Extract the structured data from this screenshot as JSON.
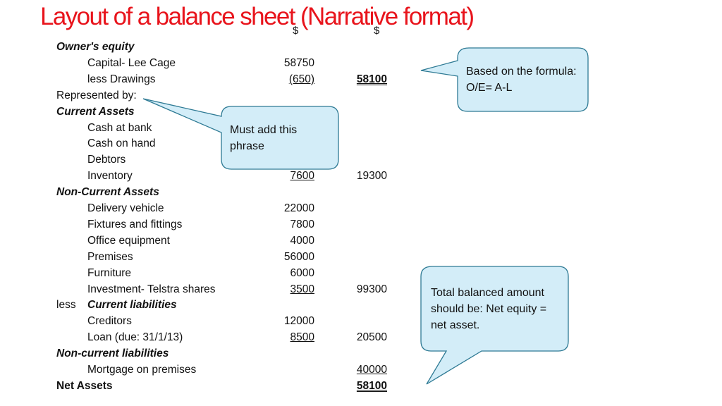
{
  "slide": {
    "title": "Layout of a balance sheet (Narrative format)",
    "col_headers": [
      "$",
      "$"
    ],
    "rows": [
      {
        "label": "Owner's equity",
        "style": "head",
        "col1": "",
        "col2": ""
      },
      {
        "label": "Capital- Lee Cage",
        "style": "item",
        "col1": "58750",
        "col2": ""
      },
      {
        "label": "less Drawings",
        "style": "item",
        "col1": "(650)",
        "col1_underline": true,
        "col2": "58100",
        "col2_style": "double"
      },
      {
        "label": "Represented by:",
        "style": "plain",
        "col1": "",
        "col2": ""
      },
      {
        "label": "Current Assets",
        "style": "head",
        "col1": "",
        "col2": ""
      },
      {
        "label": "Cash at bank",
        "style": "item",
        "col1": "",
        "col2": ""
      },
      {
        "label": "Cash on hand",
        "style": "item",
        "col1": "",
        "col2": ""
      },
      {
        "label": "Debtors",
        "style": "item",
        "col1": "",
        "col2": ""
      },
      {
        "label": "Inventory",
        "style": "item",
        "col1": "7600",
        "col1_underline": true,
        "col2": "19300"
      },
      {
        "label": "Non-Current Assets",
        "style": "head",
        "col1": "",
        "col2": ""
      },
      {
        "label": "Delivery vehicle",
        "style": "item",
        "col1": "22000",
        "col2": ""
      },
      {
        "label": "Fixtures and fittings",
        "style": "item",
        "col1": "7800",
        "col2": ""
      },
      {
        "label": "Office equipment",
        "style": "item",
        "col1": "4000",
        "col2": ""
      },
      {
        "label": "Premises",
        "style": "item",
        "col1": "56000",
        "col2": ""
      },
      {
        "label": "Furniture",
        "style": "item",
        "col1": "6000",
        "col2": ""
      },
      {
        "label": "Investment- Telstra shares",
        "style": "item",
        "col1": "3500",
        "col1_underline": true,
        "col2": "99300"
      },
      {
        "label": "Current liabilities",
        "prefix": "less",
        "style": "head-item",
        "col1": "",
        "col2": ""
      },
      {
        "label": "Creditors",
        "style": "item",
        "col1": "12000",
        "col2": ""
      },
      {
        "label": "Loan (due: 31/1/13)",
        "style": "item",
        "col1": "8500",
        "col1_underline": true,
        "col2": "20500"
      },
      {
        "label": "Non-current liabilities",
        "style": "head",
        "col1": "",
        "col2": ""
      },
      {
        "label": "Mortgage on premises",
        "style": "item",
        "col1": "",
        "col2": "40000",
        "col2_style": "underline"
      },
      {
        "label": "Net Assets",
        "style": "bold",
        "col1": "",
        "col2": "58100",
        "col2_style": "double"
      }
    ],
    "callouts": {
      "formula": "Based on the formula: O/E= A-L",
      "phrase": "Must add this phrase",
      "balanced": "Total balanced amount should be: Net equity = net asset."
    },
    "colors": {
      "title": "#e8141c",
      "callout_fill": "#d3edf8",
      "callout_stroke": "#2e7a94"
    }
  }
}
